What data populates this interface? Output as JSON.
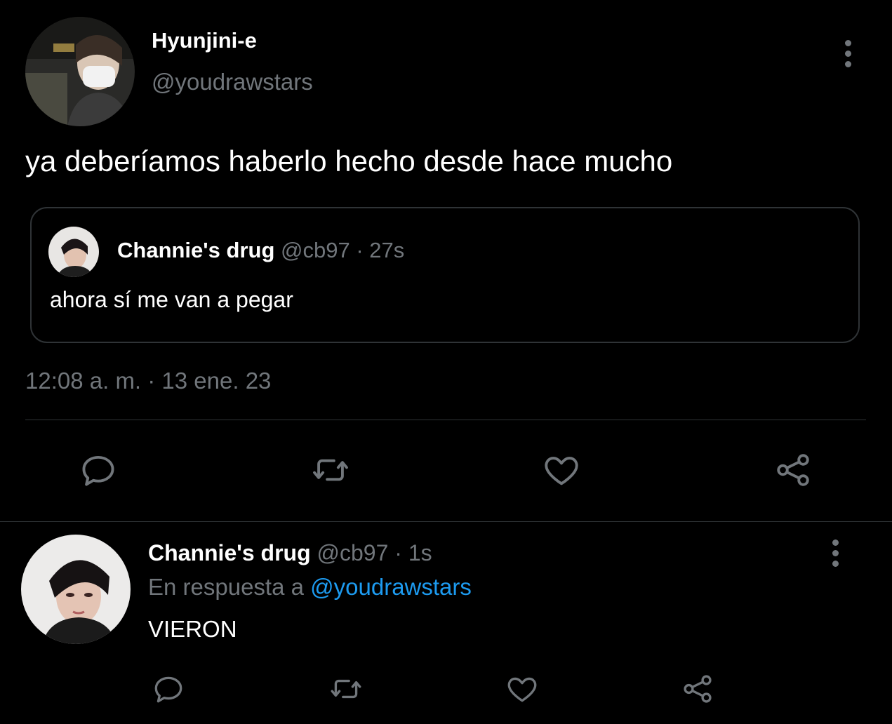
{
  "main_tweet": {
    "display_name": "Hyunjini-e",
    "handle": "@youdrawstars",
    "text": "ya deberíamos haberlo hecho desde hace mucho",
    "timestamp": "12:08 a. m. · 13 ene. 23",
    "avatar_icon": "avatar-photo",
    "quoted": {
      "display_name": "Channie's drug",
      "handle": "@cb97",
      "separator": "·",
      "time": "27s",
      "text": "ahora sí me van a pegar"
    },
    "actions": [
      "reply-icon",
      "retweet-icon",
      "like-icon",
      "share-icon"
    ]
  },
  "reply_tweet": {
    "display_name": "Channie's drug",
    "handle": "@cb97",
    "separator": "·",
    "time": "1s",
    "reply_prefix": "En respuesta a",
    "reply_to": "@youdrawstars",
    "text": "VIERON",
    "actions": [
      "reply-icon",
      "retweet-icon",
      "like-icon",
      "share-icon"
    ]
  },
  "colors": {
    "background": "#000000",
    "text": "#e7e9ea",
    "muted": "#71767b",
    "link": "#1d9bf0",
    "border": "#2f3336"
  }
}
